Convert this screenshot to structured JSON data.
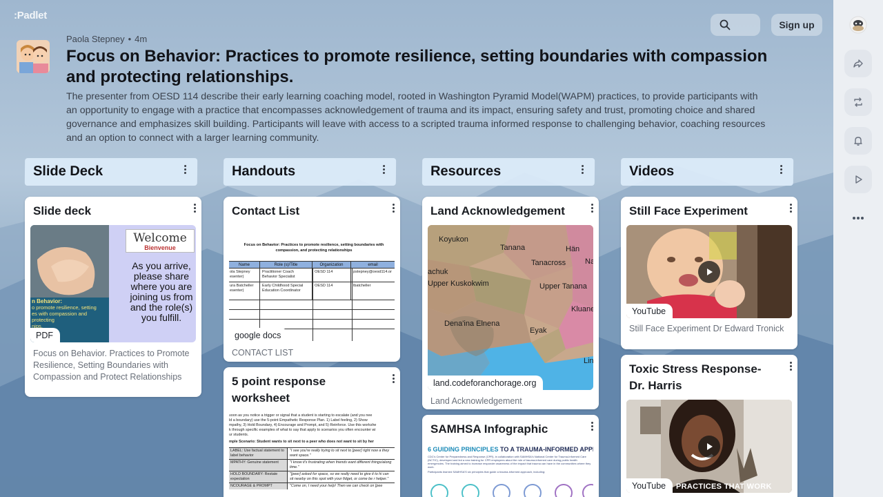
{
  "app": {
    "logo": ":Padlet"
  },
  "header": {
    "author": "Paola Stepney",
    "separator": "•",
    "time": "4m",
    "title": "Focus on Behavior: Practices to promote resilience, setting boundaries with compassion and protecting relationships.",
    "description": " The presenter from OESD 114 describe their early learning coaching model, rooted in Washington Pyramid Model(WAPM) practices, to provide participants with an opportunity to engage with a practice that encompasses acknowledgement of trauma and its impact, ensuring safety and trust, promoting choice and shared governance and emphasizes skill building. Participants will leave with access to a scripted trauma informed response to challenging behavior, coaching resources and an option to connect with a larger learning community."
  },
  "topbar": {
    "signup_label": "Sign up",
    "search_icon": "search-icon"
  },
  "columns": [
    {
      "title": "Slide Deck"
    },
    {
      "title": "Handouts"
    },
    {
      "title": "Resources"
    },
    {
      "title": "Videos"
    }
  ],
  "cards": {
    "slide_deck": {
      "title": "Slide deck",
      "tag": "PDF",
      "caption": "Focus on Behavior. Practices to Promote Resilience, Setting Boundaries with Compassion and Protect Relationships",
      "thumb_lines": [
        "Welcome",
        "Bienvenue",
        "As you arrive, please share where you are joining us from and the role(s) you fulfill."
      ],
      "thumb_overlay": [
        "n Behavior:",
        "o promote resilience, setting",
        "es with compassion and protecting",
        "nips."
      ]
    },
    "contact_list": {
      "title": "Contact List",
      "tag": "google docs",
      "caption": "CONTACT LIST",
      "doc_title": "Focus on Behavior:  Practices to promote resilience, setting boundaries with compassion, and protecting relationships",
      "table_headers": [
        "Name",
        "Role (s)/Title",
        "Organization",
        "email"
      ],
      "table_rows": [
        [
          "ola Stepney esenter)",
          "Practitioner Coach Behavior Specialist",
          "OESD 114",
          "pstepney@oesd114.or"
        ],
        [
          "ura Batcheller esenter)",
          "Early Childhood Special Education Coordinator",
          "OESD 114",
          "lbatcheller"
        ]
      ]
    },
    "worksheet": {
      "title": "5 point response worksheet",
      "lines": [
        "soon as you notice a trigger or signal that a student is starting to escalate (and you nee",
        "ld a boundary) use the 5-point Empathetic Response Plan. 1) Label feeling, 2) Show",
        "mpathy, 3) Hold Boundary, 4) Encourage and Prompt, and 5) Reinforce. Use this workshe",
        "k through specific examples of what to say that apply to scenarios you often encounter wi",
        "ur students.",
        "mple Scenario: Student wants to sit next to a peer who does not want to sit by her"
      ],
      "rows": [
        [
          "LABEL: Use factual statement to label behavior",
          "\"I see you're really trying to sit next to [peer] right now a they want space.\""
        ],
        [
          "MPATHY: Genuine statement",
          "\"I know it's frustrating when friends want different things/along time.\""
        ],
        [
          "HOLD BOUNDARY: Restate expectation",
          "\"[peer] asked for space, so we really need to give it to hi can sit nearby on this spot with your fidget, or come be r helper.\""
        ],
        [
          "NCOURAGE & PROMPT",
          "\"Come on, I need your help! Then we can check on [pee"
        ]
      ]
    },
    "land_ack": {
      "title": "Land Acknowledgement",
      "tag": "land.codeforanchorage.org",
      "caption": "Land Acknowledgement",
      "map_labels": [
        "Koyukon",
        "Tanana",
        "Hän",
        "achuk",
        "Tanacross",
        "Na",
        "Upper Kuskokwim",
        "Upper Tanana",
        "Kluane",
        "Dena'ina Elnena",
        "Eyak",
        "Lin"
      ]
    },
    "samhsa": {
      "title": "SAMHSA Infographic",
      "headline_a": "6 GUIDING PRINCIPLES",
      "headline_b": " TO A TRAUMA-INFORMED APPROACH",
      "body": "CDC's Center for Preparedness and Response (CPR), in collaboration with SAMHSA's National Center for Trauma-Informed Care (NCTIC), developed and led a new training for CPR employees about the role of trauma-informed care during public health emergencies. The training aimed to increase responder awareness of the impact that trauma can have in the communities where they work.",
      "body2": "Participants learned SAMHSA'S six principles that guide a trauma-informed approach, including:"
    },
    "still_face": {
      "title": "Still Face Experiment",
      "tag": "YouTube",
      "caption": "Still Face Experiment  Dr  Edward Tronick"
    },
    "toxic_stress": {
      "title": "Toxic Stress Response- Dr. Harris",
      "tag": "YouTube",
      "banner": "PRACTICES THAT WORK"
    }
  }
}
